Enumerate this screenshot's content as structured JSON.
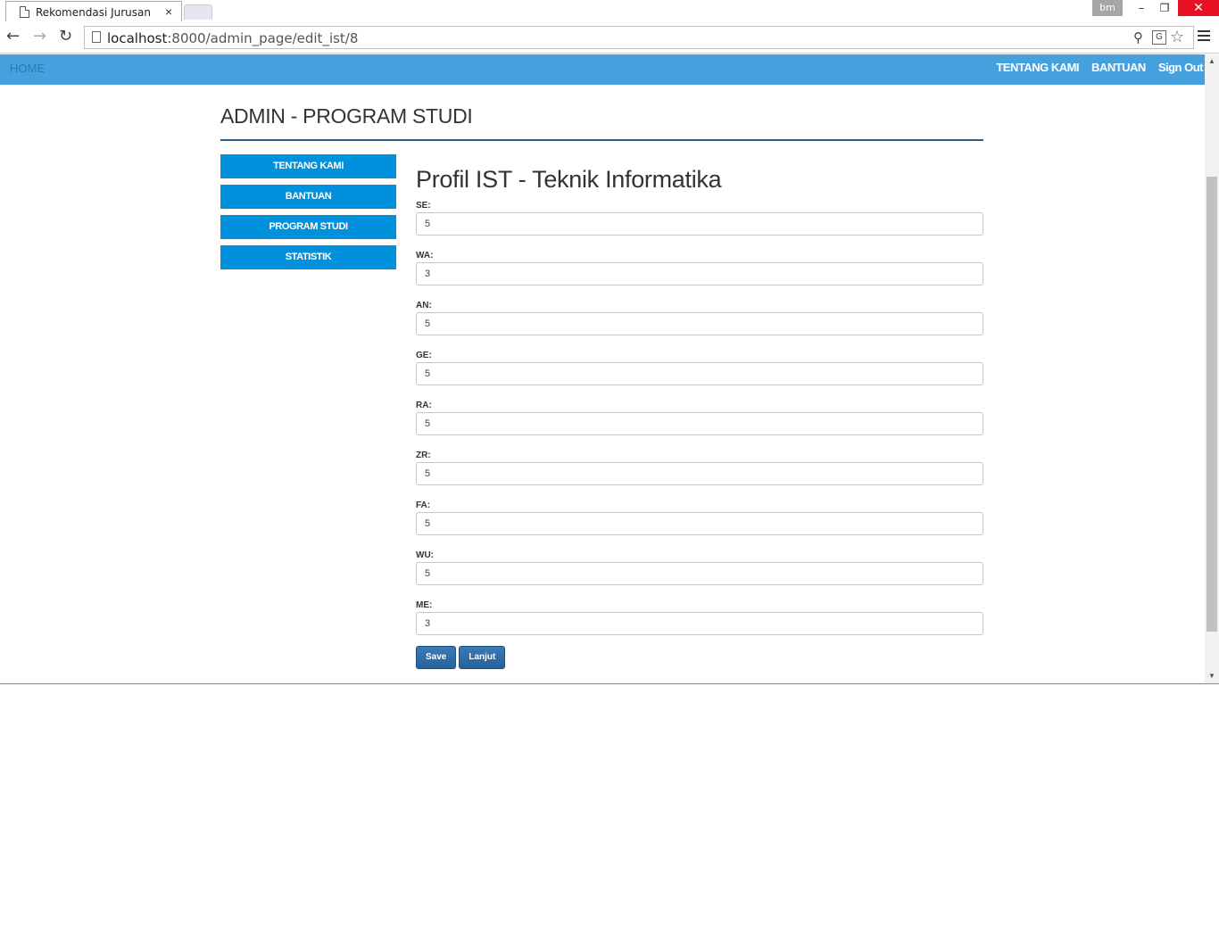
{
  "browser": {
    "tab_title": "Rekomendasi Jurusan",
    "tab_close": "×",
    "profile": "bm",
    "win_min": "–",
    "win_max": "❐",
    "win_close": "✕",
    "back": "←",
    "forward": "→",
    "reload": "↻",
    "url_host": "localhost",
    "url_path": ":8000/admin_page/edit_ist/8",
    "zoom_icon": "⚲",
    "translate_icon": "G",
    "star_icon": "☆"
  },
  "navbar": {
    "home": "HOME",
    "links": [
      "TENTANG KAMI",
      "BANTUAN",
      "Sign Out"
    ]
  },
  "page": {
    "heading": "ADMIN - PROGRAM STUDI"
  },
  "sidebar": {
    "items": [
      {
        "label": "TENTANG KAMI"
      },
      {
        "label": "BANTUAN"
      },
      {
        "label": "PROGRAM STUDI"
      },
      {
        "label": "STATISTIK"
      }
    ]
  },
  "form": {
    "title": "Profil IST - Teknik Informatika",
    "fields": [
      {
        "label": "SE:",
        "value": "5"
      },
      {
        "label": "WA:",
        "value": "3"
      },
      {
        "label": "AN:",
        "value": "5"
      },
      {
        "label": "GE:",
        "value": "5"
      },
      {
        "label": "RA:",
        "value": "5"
      },
      {
        "label": "ZR:",
        "value": "5"
      },
      {
        "label": "FA:",
        "value": "5"
      },
      {
        "label": "WU:",
        "value": "5"
      },
      {
        "label": "ME:",
        "value": "3"
      }
    ],
    "save_label": "Save",
    "next_label": "Lanjut"
  },
  "colors": {
    "navbar": "#45a1dd",
    "sidebar_button": "#0191dc",
    "action_button": "#2f6da8"
  }
}
